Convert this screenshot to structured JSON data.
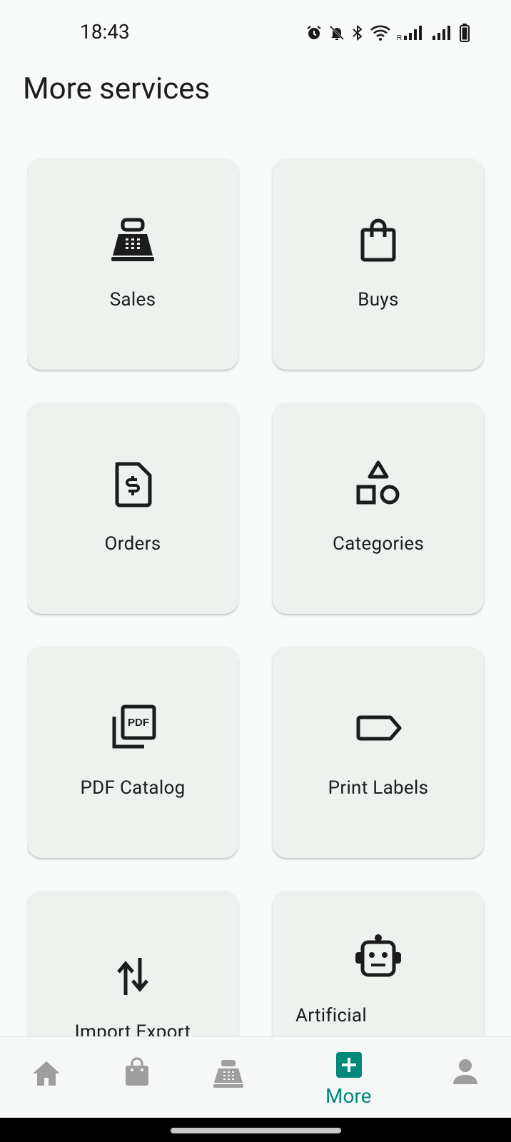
{
  "status_bar": {
    "time": "18:43",
    "roaming_indicator": "R"
  },
  "page": {
    "title": "More services"
  },
  "services": [
    {
      "label": "Sales",
      "icon": "cash-register-icon"
    },
    {
      "label": "Buys",
      "icon": "shopping-bag-icon"
    },
    {
      "label": "Orders",
      "icon": "dollar-document-icon"
    },
    {
      "label": "Categories",
      "icon": "shapes-icon"
    },
    {
      "label": "PDF Catalog",
      "icon": "pdf-icon"
    },
    {
      "label": "Print Labels",
      "icon": "label-tag-icon"
    },
    {
      "label": "Import Export",
      "icon": "import-export-arrows-icon"
    },
    {
      "label": "Artificial",
      "icon": "robot-icon"
    }
  ],
  "bottom_nav": {
    "items": [
      {
        "label": "Home",
        "icon": "home-icon",
        "active": false
      },
      {
        "label": "Shop",
        "icon": "shopping-bag-icon",
        "active": false
      },
      {
        "label": "Sales",
        "icon": "cash-register-icon",
        "active": false
      },
      {
        "label": "More",
        "icon": "add-box-icon",
        "active": true
      },
      {
        "label": "Profile",
        "icon": "person-icon",
        "active": false
      }
    ],
    "active_color": "#00897b",
    "inactive_color": "#9e9e9e"
  }
}
